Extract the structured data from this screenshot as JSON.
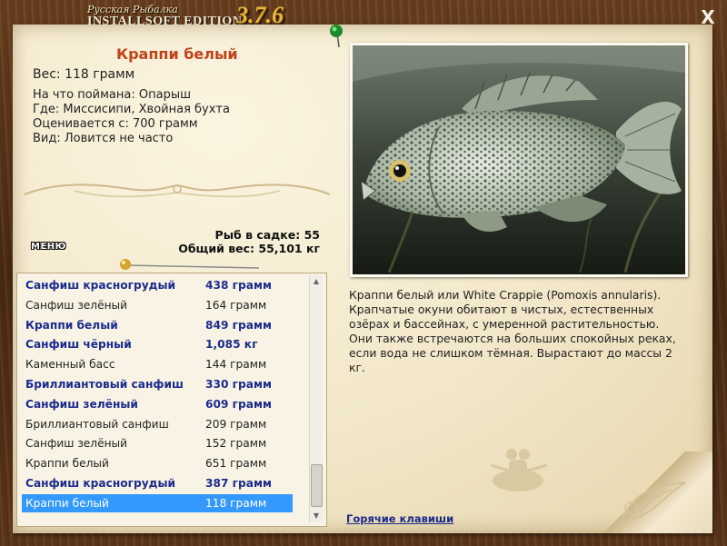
{
  "app": {
    "title_small": "Русская Рыбалка",
    "title_big": "INSTALLSOFT EDITION",
    "version": "3.7.6",
    "close_glyph": "X"
  },
  "fish": {
    "name": "Краппи белый",
    "weight": "Вес: 118 грамм",
    "caught_with": "На что поймана: Опарыш",
    "where": "Где: Миссисипи, Хвойная бухта",
    "value": "Оценивается с: 700 грамм",
    "kind": "Вид: Ловится не часто"
  },
  "stats": {
    "count": "Рыб в садке: 55",
    "total": "Общий вес: 55,101 кг"
  },
  "menu_label": "МЕНЮ",
  "description": "Краппи белый или White Crappie (Pomoxis annularis). Крапчатые окуни обитают в чистых, естественных озёрах и бассейнах, с умеренной растительностью. Они также встречаются на больших спокойных реках, если вода не слишком тёмная. Вырастают до массы 2 кг.",
  "hotkeys": "Горячие клавиши",
  "catch_list": [
    {
      "name": "Санфиш красногрудый",
      "weight": "438 грамм",
      "style": "bold"
    },
    {
      "name": "Санфиш зелёный",
      "weight": "164 грамм",
      "style": "norm"
    },
    {
      "name": "Краппи белый",
      "weight": "849 грамм",
      "style": "bold"
    },
    {
      "name": "Санфиш чёрный",
      "weight": "1,085 кг",
      "style": "bold"
    },
    {
      "name": "Каменный басс",
      "weight": "144 грамм",
      "style": "norm"
    },
    {
      "name": "Бриллиантовый санфиш",
      "weight": "330 грамм",
      "style": "bold"
    },
    {
      "name": "Санфиш зелёный",
      "weight": "609 грамм",
      "style": "bold"
    },
    {
      "name": "Бриллиантовый санфиш",
      "weight": "209 грамм",
      "style": "norm"
    },
    {
      "name": "Санфиш зелёный",
      "weight": "152 грамм",
      "style": "norm"
    },
    {
      "name": "Краппи белый",
      "weight": "651 грамм",
      "style": "norm"
    },
    {
      "name": "Санфиш красногрудый",
      "weight": "387 грамм",
      "style": "bold"
    },
    {
      "name": "Краппи белый",
      "weight": "118 грамм",
      "style": "sel"
    }
  ],
  "icons": {
    "close": "close-icon",
    "pin": "pin-icon",
    "scroll_up": "scroll-up-icon",
    "scroll_down": "scroll-down-icon"
  },
  "colors": {
    "fish_name": "#c0421a",
    "bold_row": "#1c2c8e",
    "selected_row": "#3399ff",
    "version": "#e8b73b"
  }
}
